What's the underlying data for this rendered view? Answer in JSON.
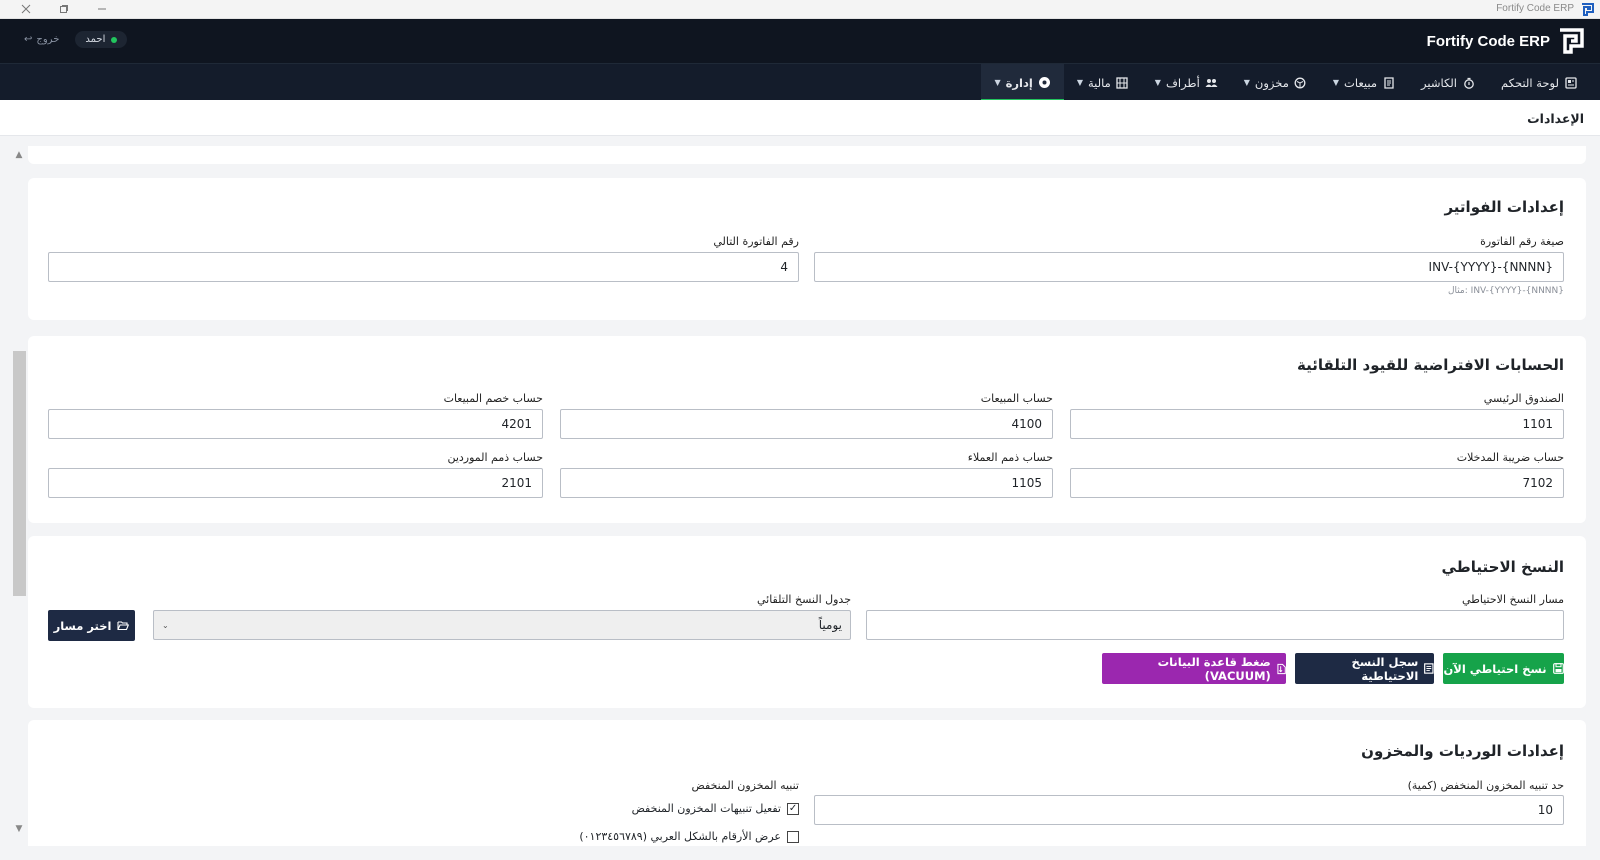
{
  "window": {
    "title": "Fortify Code ERP",
    "controls": [
      "close",
      "restore",
      "minimize"
    ]
  },
  "header": {
    "brand": "Fortify Code ERP",
    "user": "احمد",
    "logout": "خروج"
  },
  "nav": {
    "items": [
      {
        "label": "لوحة التحكم",
        "icon": "dashboard-icon",
        "dropdown": false
      },
      {
        "label": "الكاشير",
        "icon": "cashier-icon",
        "dropdown": false
      },
      {
        "label": "مبيعات",
        "icon": "receipt-icon",
        "dropdown": true
      },
      {
        "label": "مخزون",
        "icon": "box-icon",
        "dropdown": true
      },
      {
        "label": "أطراف",
        "icon": "users-icon",
        "dropdown": true
      },
      {
        "label": "مالية",
        "icon": "finance-icon",
        "dropdown": true
      },
      {
        "label": "إدارة",
        "icon": "gear-icon",
        "dropdown": true,
        "active": true
      }
    ],
    "active_color": "#22c55e"
  },
  "page": {
    "title": "الإعدادات"
  },
  "invoices": {
    "title": "إعدادات الفواتير",
    "format_label": "صيغة رقم الفاتورة",
    "format_value": "INV-{YYYY}-{NNNN}",
    "format_hint": "مثال: INV-{YYYY}-{NNNN}",
    "next_label": "رقم الفاتورة التالي",
    "next_value": "4"
  },
  "accounts": {
    "title": "الحسابات الافتراضية للقيود التلقائية",
    "main_cash_label": "الصندوق الرئيسي",
    "main_cash_value": "1101",
    "sales_label": "حساب المبيعات",
    "sales_value": "4100",
    "sales_discount_label": "حساب خصم المبيعات",
    "sales_discount_value": "4201",
    "input_tax_label": "حساب ضريبة المدخلات",
    "input_tax_value": "7102",
    "receivables_label": "حساب ذمم العملاء",
    "receivables_value": "1105",
    "payables_label": "حساب ذمم الموردين",
    "payables_value": "2101"
  },
  "backup": {
    "title": "النسخ الاحتياطي",
    "path_label": "مسار النسخ الاحتياطي",
    "path_value": "",
    "schedule_label": "جدول النسخ التلقائي",
    "schedule_value": "يومياً",
    "choose_path_button": "اختر مسار",
    "backup_now_button": "نسخ احتياطي الآن",
    "backup_log_button": "سجل النسخ الاحتياطية",
    "vacuum_button": "ضغط قاعدة البيانات (VACUUM)",
    "colors": {
      "green": "#16a34a",
      "navy": "#1e2a44",
      "purple": "#9b27af"
    }
  },
  "inventory": {
    "title": "إعدادات الورديات والمخزون",
    "low_stock_threshold_label": "حد تنبيه المخزون المنخفض (كمية)",
    "low_stock_threshold_value": "10",
    "low_stock_alert_label": "تنبيه المخزون المنخفض",
    "enable_alerts_label": "تفعيل تنبيهات المخزون المنخفض",
    "enable_alerts_checked": true,
    "arabic_numerals_label": "عرض الأرقام بالشكل العربي (٠١٢٣٤٥٦٧٨٩)",
    "arabic_numerals_checked": false
  }
}
